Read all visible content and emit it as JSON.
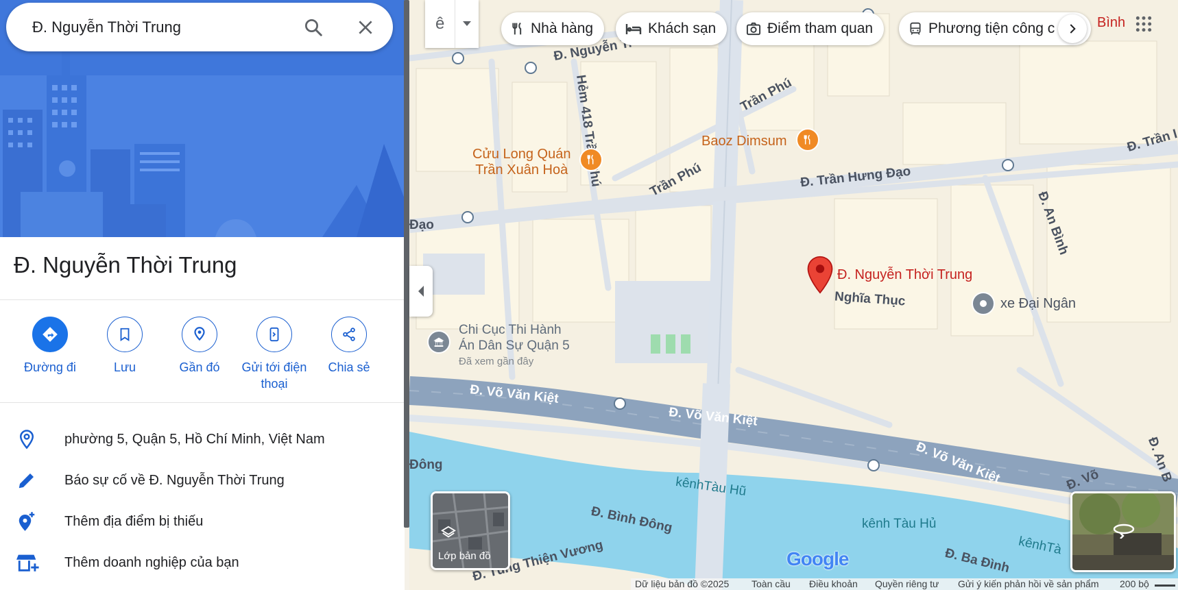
{
  "search": {
    "value": "Đ. Nguyễn Thời Trung"
  },
  "place": {
    "title": "Đ. Nguyễn Thời Trung"
  },
  "actions": [
    {
      "label": "Đường đi"
    },
    {
      "label": "Lưu"
    },
    {
      "label": "Gần đó"
    },
    {
      "label": "Gửi tới điện thoại"
    },
    {
      "label": "Chia sẻ"
    }
  ],
  "info": {
    "address": "phường 5, Quận 5, Hồ Chí Minh, Việt Nam",
    "report": "Báo sự cố về Đ. Nguyễn Thời Trung",
    "add_place": "Thêm địa điểm bị thiếu",
    "add_business": "Thêm doanh nghiệp của bạn"
  },
  "map": {
    "lang_glyph": "ê",
    "chips": [
      {
        "label": "Nhà hàng",
        "icon": "restaurant-icon"
      },
      {
        "label": "Khách sạn",
        "icon": "hotel-icon"
      },
      {
        "label": "Điểm tham quan",
        "icon": "camera-icon"
      },
      {
        "label": "Phương tiện công c",
        "icon": "transit-icon"
      }
    ],
    "corner_label": "Bình",
    "pois": {
      "cuu_long_line1": "Cửu Long Quán",
      "cuu_long_line2": "Trần Xuân Hoà",
      "baoz": "Baoz Dimsum",
      "pin_label": "Đ. Nguyễn Thời Trung",
      "xe_dai_ngan": "xe Đại Ngân",
      "chi_cuc_line1": "Chi Cục Thi Hành",
      "chi_cuc_line2": "Án Dân Sự Quận 5",
      "chi_cuc_sub": "Đã xem gần đây"
    },
    "streets": {
      "nguyen_top": "Đ. Nguyễn Tr",
      "hem_418": "Hẻm 418 Trần Phú",
      "tran_phu_1": "Trần Phú",
      "tran_phu_2": "Trần Phú",
      "tran_hung_dao": "Đ. Trần Hưng Đạo",
      "tran_right": "Đ. Trần I",
      "dao_left": "Đạo",
      "an_binh": "Đ. An Bình",
      "an_binh_2": "Đ. An B",
      "nghia_thuc": "Nghĩa Thục",
      "vo_van_kiet_1": "Đ. Võ Văn Kiệt",
      "vo_van_kiet_2": "Đ. Võ Văn Kiệt",
      "vo_van_kiet_3": "Đ. Võ Văn Kiệt",
      "vo_right": "Đ. Võ",
      "dong_left": "Đông",
      "binh_dong": "Đ. Bình Đông",
      "tung_thien_vuong": "Đ. Tùng Thiện Vương",
      "ba_dinh": "Đ. Ba Đình",
      "kenh_1": "kênhTàu Hũ",
      "kenh_2": "kênh Tàu Hủ",
      "kenh_3": "kênhTà"
    },
    "layers_label": "Lớp bản đồ",
    "google_logo": "Google",
    "footer": {
      "data": "Dữ liệu bản đồ ©2025",
      "global": "Toàn cầu",
      "terms": "Điều khoản",
      "privacy": "Quyền riêng tư",
      "feedback": "Gửi ý kiến phản hồi về sản phẩm",
      "scale": "200 bộ"
    }
  },
  "colors": {
    "accent": "#1a73e8",
    "pin": "#ea4335",
    "water": "#8fd3ec",
    "highway": "#8da3bd",
    "poi_orange": "#c5631b"
  }
}
